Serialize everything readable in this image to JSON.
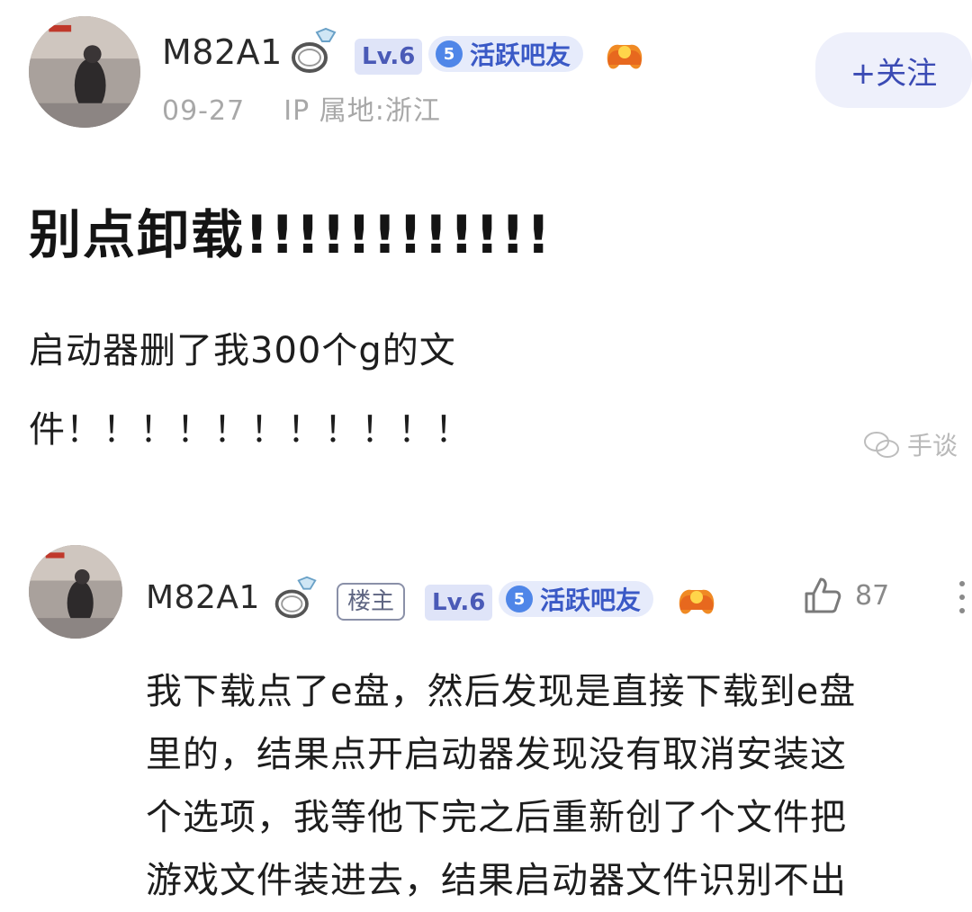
{
  "post": {
    "username": "M82A1",
    "level_badge": "Lv.6",
    "active_badge": {
      "number": "5",
      "label": "活跃吧友"
    },
    "date": "09-27",
    "ip_location": "IP 属地:浙江",
    "follow_label": "+关注",
    "title": "别点卸载!!!!!!!!!!!!",
    "body_lines": [
      "启动器删了我300个g的文",
      "件！！！！！！！！！！！"
    ]
  },
  "watermark": "手谈",
  "reply": {
    "username": "M82A1",
    "owner_badge": "楼主",
    "level_badge": "Lv.6",
    "active_badge": {
      "number": "5",
      "label": "活跃吧友"
    },
    "like_count": "87",
    "lines": [
      "我下载点了e盘，然后发现是直接下载到e盘",
      "里的，结果点开启动器发现没有取消安装这",
      "个选项，我等他下完之后重新创了个文件把",
      "游戏文件装进去，结果启动器文件识别不出"
    ]
  },
  "colors": {
    "accent_blue": "#3b4bb4",
    "level_bg": "#dfe4f8",
    "active_badge_bg": "#e6ebfb",
    "muted_text": "#a8a8a8"
  },
  "icons": [
    "diamond-ring-icon",
    "controller-icon",
    "thumbs-up-icon",
    "more-vertical-icon",
    "wechat-icon"
  ]
}
